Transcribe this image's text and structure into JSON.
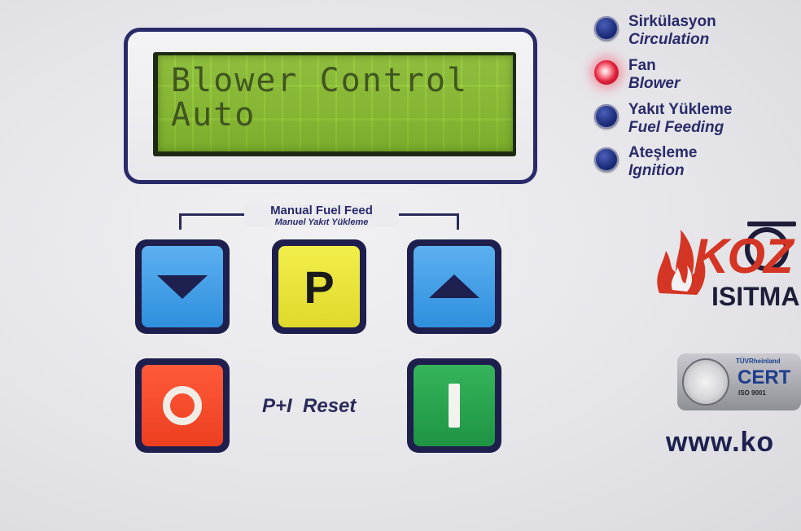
{
  "lcd": {
    "line1": "Blower Control",
    "line2": "Auto"
  },
  "indicators": [
    {
      "tr": "Sirkülasyon",
      "en": "Circulation",
      "state": "off",
      "color": "#1d2c7a"
    },
    {
      "tr": "Fan",
      "en": "Blower",
      "state": "on",
      "color": "#e0203c"
    },
    {
      "tr": "Yakıt Yükleme",
      "en": "Fuel Feeding",
      "state": "off",
      "color": "#1d2c7a"
    },
    {
      "tr": "Ateşleme",
      "en": "Ignition",
      "state": "off",
      "color": "#1d2c7a"
    }
  ],
  "manual_feed": {
    "label_en": "Manual Fuel Feed",
    "label_tr": "Manuel Yakıt Yükleme"
  },
  "keys": {
    "down": {
      "icon": "down-triangle-icon",
      "color": "#2f8fdd"
    },
    "program": {
      "label": "P",
      "color": "#e0d92c"
    },
    "up": {
      "icon": "up-triangle-icon",
      "color": "#2f8fdd"
    },
    "off": {
      "icon": "circle-off-icon",
      "color": "#ec3f20"
    },
    "on": {
      "label": "I",
      "icon": "bar-on-icon",
      "color": "#1f9444"
    }
  },
  "reset_label": "P+I  Reset",
  "brand": {
    "name": "KOZ",
    "subtitle": "ISITMA",
    "cert_text": "CERT",
    "cert_org": "TÜVRheinland",
    "cert_std": "ISO 9001",
    "website": "www.ko",
    "brand_color": "#d43524"
  }
}
